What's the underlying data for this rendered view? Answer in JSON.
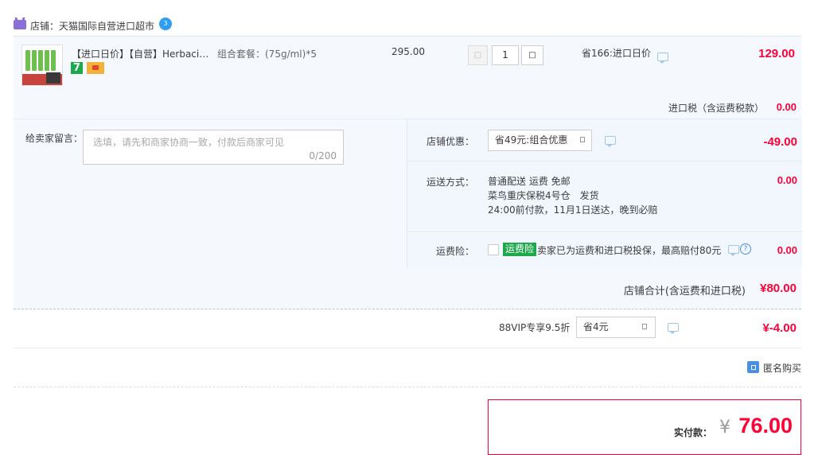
{
  "store": {
    "label": "店铺：天猫国际自营进口超市",
    "ww_badge": "3"
  },
  "item": {
    "title": "【进口日价】【自营】Herbaci…",
    "spec": "组合套餐：(75g/ml)*5",
    "unit_price": "295.00",
    "quantity": "1",
    "saving": "省166:进口日价",
    "total": "129.00",
    "badge_number": "7",
    "tax_label": "进口税（含运费税款）",
    "tax_value": "0.00"
  },
  "message": {
    "label": "给卖家留言：",
    "placeholder": "选填，请先和商家协商一致，付款后商家可见",
    "count": "0/200"
  },
  "discount": {
    "label": "店铺优惠：",
    "selected": "省49元:组合优惠",
    "value": "-49.00"
  },
  "shipping": {
    "label": "运送方式：",
    "line1": "普通配送 运费 免邮",
    "line2": "菜鸟重庆保税4号仓　发货",
    "line3": "24:00前付款，11月1日送达，晚到必赔",
    "value": "0.00"
  },
  "insurance": {
    "label": "运费险：",
    "tag": "运费险",
    "text": "卖家已为运费和进口税投保，最高赔付80元",
    "value": "0.00"
  },
  "store_total": {
    "label": "店铺合计(含运费和进口税)",
    "value": "¥80.00"
  },
  "vip": {
    "label": "88VIP专享9.5折",
    "selected": "省4元",
    "value": "¥-4.00"
  },
  "anonymous": {
    "label": "匿名购买",
    "checked": true
  },
  "payment": {
    "label": "实付款：",
    "currency": "¥",
    "amount": "76.00"
  },
  "colors": {
    "price_red": "#ff0036",
    "accent_blue": "#4a90e2",
    "tag_green": "#1ba94c",
    "row_bg": "#f5f8fd"
  },
  "icons": [
    "store-icon",
    "wangwang-icon",
    "chat-icon",
    "help-icon",
    "checkbox-icon"
  ]
}
